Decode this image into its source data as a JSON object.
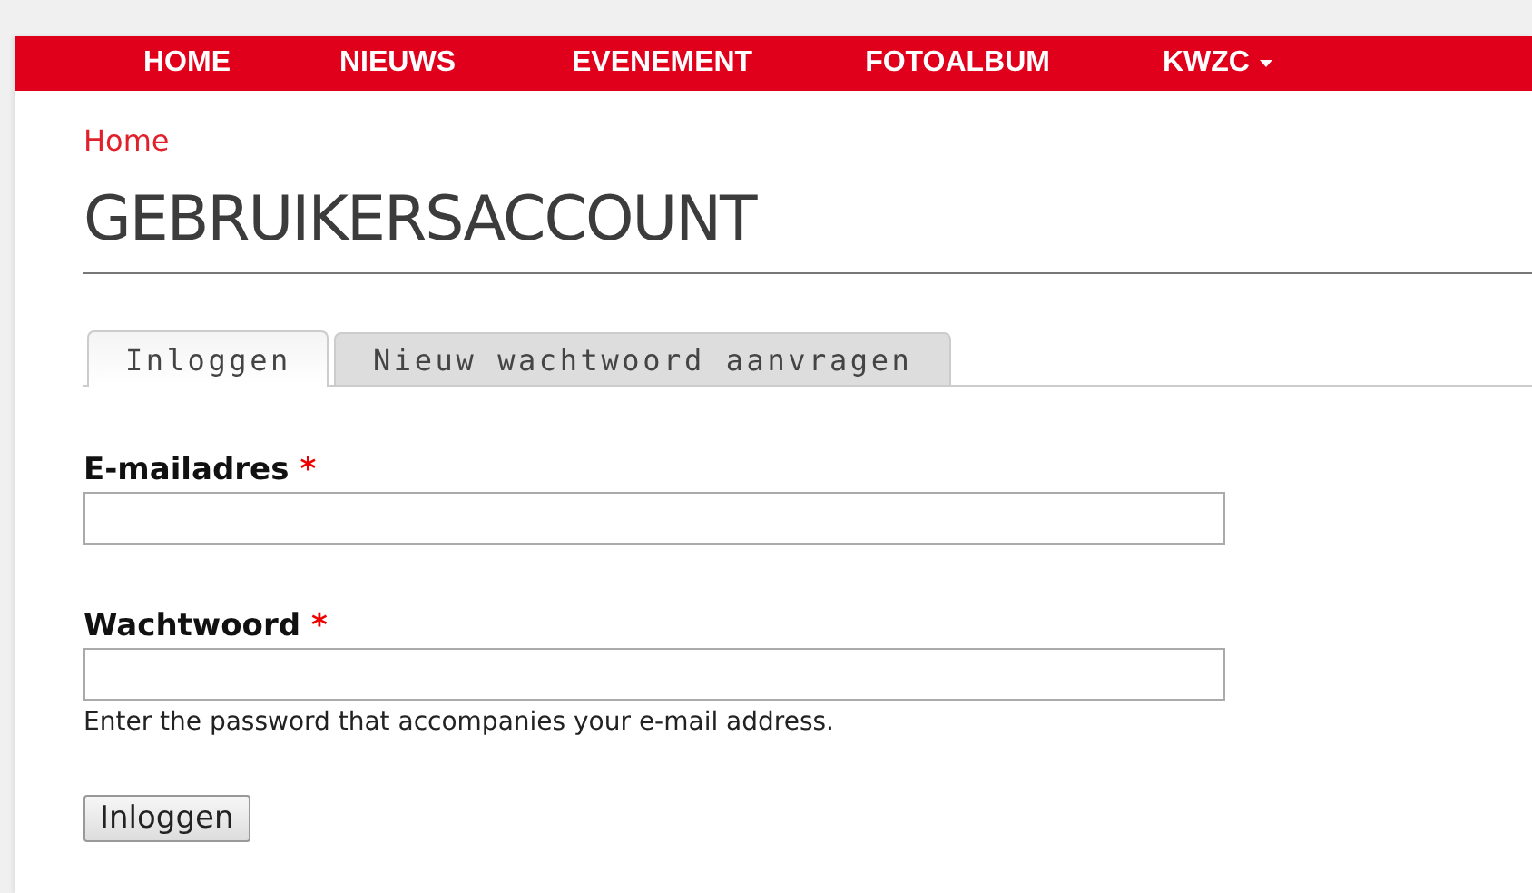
{
  "nav": {
    "items": [
      {
        "label": "HOME",
        "dropdown": false
      },
      {
        "label": "NIEUWS",
        "dropdown": false
      },
      {
        "label": "EVENEMENT",
        "dropdown": false
      },
      {
        "label": "FOTOALBUM",
        "dropdown": false
      },
      {
        "label": "KWZC",
        "dropdown": true
      }
    ]
  },
  "breadcrumb": "Home",
  "title": "GEBRUIKERSACCOUNT",
  "tabs": [
    {
      "label": "Inloggen",
      "selected": true
    },
    {
      "label": "Nieuw wachtwoord aanvragen",
      "selected": false
    }
  ],
  "fields": [
    {
      "label": "E-mailadres",
      "required_mark": "*"
    },
    {
      "label": "Wachtwoord",
      "required_mark": "*",
      "description": "Enter the password that accompanies your e-mail address."
    }
  ],
  "submit": "Inloggen"
}
